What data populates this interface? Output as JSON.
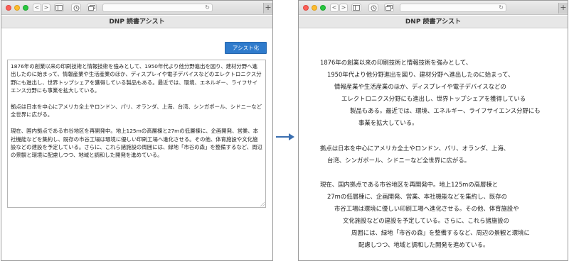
{
  "window": {
    "title": "DNP 読書アシスト",
    "nav_back": "<",
    "nav_forward": ">",
    "reload_glyph": "↻",
    "plus_glyph": "+"
  },
  "input_view": {
    "assist_button_label": "アシスト化",
    "paragraphs": [
      "1876年の創業以来の印刷技術と情報技術を強みとして、1950年代より他分野進出を図り、建材分野へ進出したのに始まって、情報産業や生活産業のほか、ディスプレイや電子デバイスなどのエレクトロニクス分野にも進出し、世界トップシェアを獲得している製品もある。最近では、環境、エネルギー、ライフサイエンス分野にも事業を拡大している。",
      "拠点は日本を中心にアメリカ全土やロンドン、パリ、オランダ、上海、台湾、シンガポール、シドニーなど全世界に広がる。",
      "現在、国内拠点である市谷地区を再開発中。地上125mの高層棟と27mの低層棟に、企画開発、営業、本社機能などを集約し、既存の市谷工場は環境に優しい印刷工場へ進化させる。その他、体育施設や文化施設などの建設を予定している。さらに、これら諸施設の周囲には、緑地「市谷の森」を整備するなど、周辺の景観と環境に配慮しつつ、地域と調和した開発を進めている。"
    ]
  },
  "assisted_view": {
    "lines": [
      "1876年の創業以来の印刷技術と情報技術を強みとして、",
      "1950年代より他分野進出を図り、建材分野へ進出したのに始まって、",
      "情報産業や生活産業のほか、ディスプレイや電子デバイスなどの",
      "エレクトロニクス分野にも進出し、世界トップシェアを獲得している",
      "製品もある。最近では、環境、エネルギー、ライフサイエンス分野にも",
      "事業を拡大している。",
      "拠点は日本を中心にアメリカ全土やロンドン、パリ、オランダ、上海、",
      "台湾、シンガポール、シドニーなど全世界に広がる。",
      "現在、国内拠点である市谷地区を再開発中。地上125mの高層棟と",
      "27mの低層棟に、企画開発、営業、本社機能などを集約し、既存の",
      "市谷工場は環境に優しい印刷工場へ進化させる。その他、体育施設や",
      "文化施設などの建設を予定している。さらに、これら諸施設の",
      "周囲には、緑地「市谷の森」を整備するなど、周辺の景観と環境に",
      "配慮しつつ、地域と調和した開発を進めている。"
    ]
  },
  "colors": {
    "accent": "#2f7bcc",
    "arrow": "#3b6fb0"
  }
}
